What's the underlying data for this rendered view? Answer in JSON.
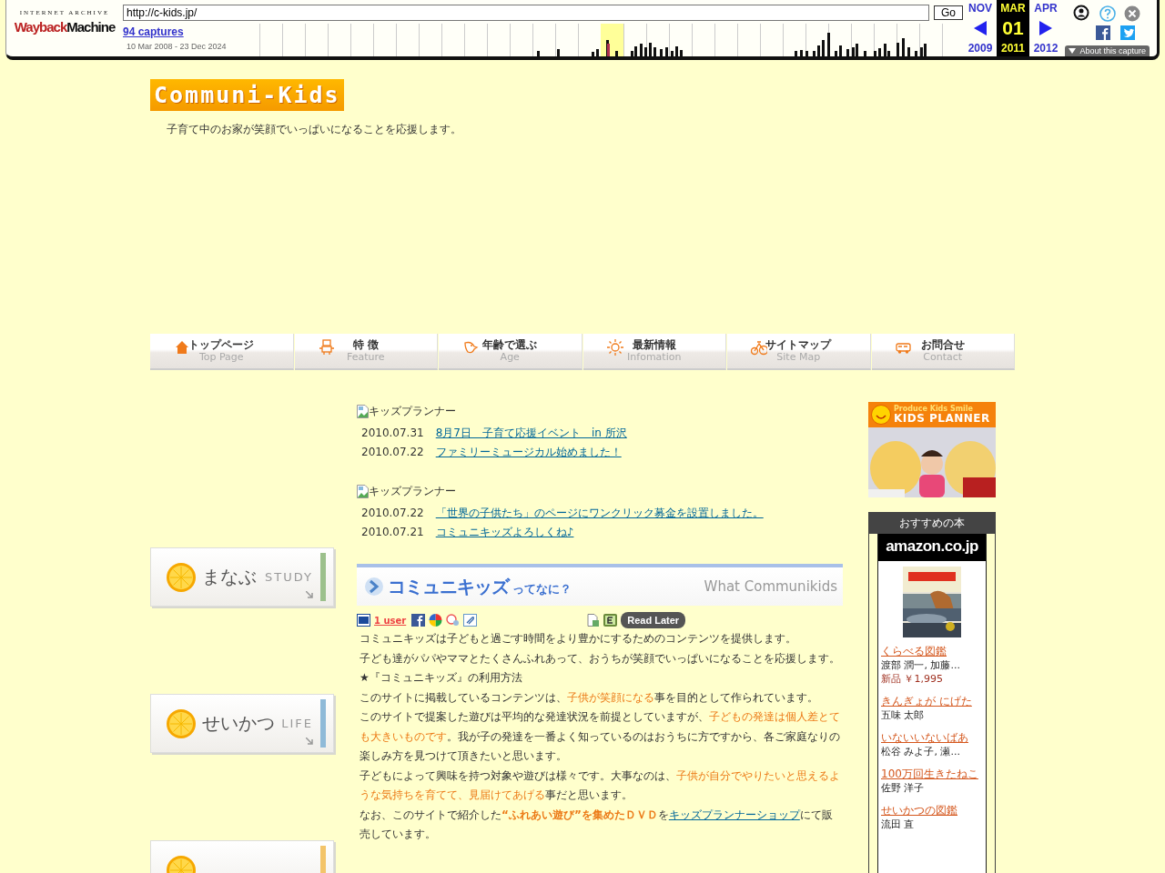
{
  "wayback": {
    "logo_top": "INTERNET ARCHIVE",
    "logo_wayback": "Wayback",
    "logo_machine": "Machine",
    "url": "http://c-kids.jp/",
    "go": "Go",
    "captures": "94 captures",
    "range": "10 Mar 2008 - 23 Dec 2024",
    "prev": {
      "month": "NOV",
      "year": "2009"
    },
    "current": {
      "month": "MAR",
      "day": "01",
      "year": "2011"
    },
    "next": {
      "month": "APR",
      "year": "2012"
    },
    "about": "About this capture"
  },
  "header": {
    "logo": "Communi-Kids",
    "tagline": "子育て中のお家が笑顔でいっぱいになることを応援します。"
  },
  "nav": [
    {
      "label": "トップページ",
      "sub": "Top Page"
    },
    {
      "label": "特 徴",
      "sub": "Feature"
    },
    {
      "label": "年齢で選ぶ",
      "sub": "Age"
    },
    {
      "label": "最新情報",
      "sub": "Infomation"
    },
    {
      "label": "サイトマップ",
      "sub": "Site Map"
    },
    {
      "label": "お問合せ",
      "sub": "Contact"
    }
  ],
  "side_menu": [
    {
      "label": "まなぶ",
      "sub": "STUDY",
      "color": "#9cc08c"
    },
    {
      "label": "せいかつ",
      "sub": "LIFE",
      "color": "#8fbad8"
    },
    {
      "color": "#f3c46a"
    }
  ],
  "news_blocks": [
    {
      "image_alt": "キッズプランナー",
      "items": [
        {
          "date": "2010.07.31",
          "title": "8月7日　子育て応援イベント　in 所沢"
        },
        {
          "date": "2010.07.22",
          "title": "ファミリーミュージカル始めました！"
        }
      ]
    },
    {
      "image_alt": "キッズプランナー",
      "items": [
        {
          "date": "2010.07.22",
          "title": "「世界の子供たち」のページにワンクリック募金を設置しました。"
        },
        {
          "date": "2010.07.21",
          "title": "コミュニキッズよろしくね♪"
        }
      ]
    }
  ],
  "about": {
    "title": "コミュニキッズ",
    "title_suffix": "ってなに？",
    "title_en": "What Communikids",
    "bookmark_count": "1 user",
    "read_later": "Read Later",
    "paragraphs": [
      [
        {
          "kind": "plain",
          "text": "コミュニキッズは子どもと過ごす時間をより豊かにするためのコンテンツを提供します。"
        }
      ],
      [
        {
          "kind": "plain",
          "text": "子ども達がパパやママとたくさんふれあって、おうちが笑顔でいっぱいになることを応援します。"
        }
      ],
      [
        {
          "kind": "plain",
          "text": "★『コミュニキッズ』の利用方法"
        }
      ],
      [
        {
          "kind": "plain",
          "text": "このサイトに掲載しているコンテンツは、"
        },
        {
          "kind": "highlight",
          "text": "子供が笑顔になる"
        },
        {
          "kind": "plain",
          "text": "事を目的として作られています。"
        }
      ],
      [
        {
          "kind": "plain",
          "text": "このサイトで提案した遊びは平均的な発達状況を前提としていますが、"
        },
        {
          "kind": "highlight",
          "text": "子どもの発達は個人差とても大きいものです"
        },
        {
          "kind": "plain",
          "text": "。我が子の発達を一番よく知っているのはおうちに方ですから、各ご家庭なりの楽しみ方を見つけて頂きたいと思います。"
        }
      ],
      [
        {
          "kind": "plain",
          "text": "子どもによって興味を持つ対象や遊びは様々です。大事なのは、"
        },
        {
          "kind": "highlight",
          "text": "子供が自分でやりたいと思えるような気持ちを育てて、見届けてあげる"
        },
        {
          "kind": "plain",
          "text": "事だと思います。"
        }
      ],
      [
        {
          "kind": "plain",
          "text": "なお、このサイトで紹介した"
        },
        {
          "kind": "strong",
          "text": "“ふれあい遊び”を集めたＤＶＤ"
        },
        {
          "kind": "plain",
          "text": "を"
        },
        {
          "kind": "link",
          "text": "キッズプランナーショップ"
        },
        {
          "kind": "plain",
          "text": "にて販売しています。"
        }
      ]
    ]
  },
  "sidebar": {
    "banner": {
      "tagline": "Produce Kids Smile",
      "title": "KIDS PLANNER"
    },
    "books": {
      "title": "おすすめの本",
      "store": "amazon.co.jp",
      "items": [
        {
          "title": "くらべる図鑑",
          "author": "渡部 潤一, 加藤...",
          "price": "新品 ￥1,995"
        },
        {
          "title": "きんぎょが にげた",
          "author": "五味 太郎"
        },
        {
          "title": "いないいないばあ",
          "author": "松谷 みよ子, 瀬..."
        },
        {
          "title": "100万回生きたねこ",
          "author": "佐野 洋子"
        },
        {
          "title": "せいかつの図鑑",
          "author": "流田 直"
        }
      ]
    }
  }
}
